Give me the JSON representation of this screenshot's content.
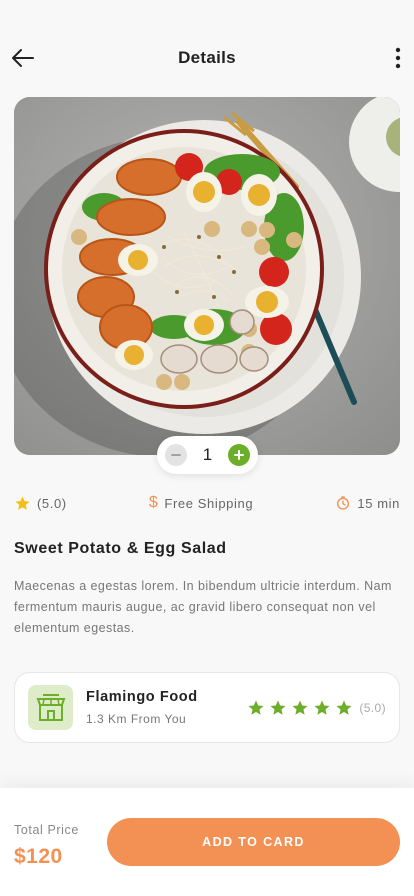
{
  "header": {
    "title": "Details",
    "back_icon": "arrow-left-icon",
    "more_icon": "more-vertical-icon"
  },
  "hero": {
    "image": "sweet-potato-egg-salad-bowl-photo"
  },
  "quantity": {
    "value": "1",
    "minus_icon": "minus-icon",
    "plus_icon": "plus-icon"
  },
  "meta": {
    "rating": "(5.0)",
    "shipping": "Free Shipping",
    "time": "15 min",
    "rating_icon": "star-icon",
    "shipping_icon": "dollar-icon",
    "time_icon": "stopwatch-icon"
  },
  "product": {
    "name": "Sweet Potato & Egg Salad",
    "description": "Maecenas a egestas lorem. In bibendum ultricie interdum. Nam fermentum  mauris augue, ac gravid libero consequat non vel elementum egestas."
  },
  "store": {
    "name": "Flamingo Food",
    "distance": "1.3 Km From You",
    "rating": "(5.0)",
    "stars": 5,
    "logo_icon": "store-icon"
  },
  "footer": {
    "total_label": "Total Price",
    "total_value": "$120",
    "add_button": "ADD TO CARD"
  },
  "colors": {
    "accent": "#f39054",
    "green": "#6cae2a",
    "star": "#f2bf15"
  }
}
